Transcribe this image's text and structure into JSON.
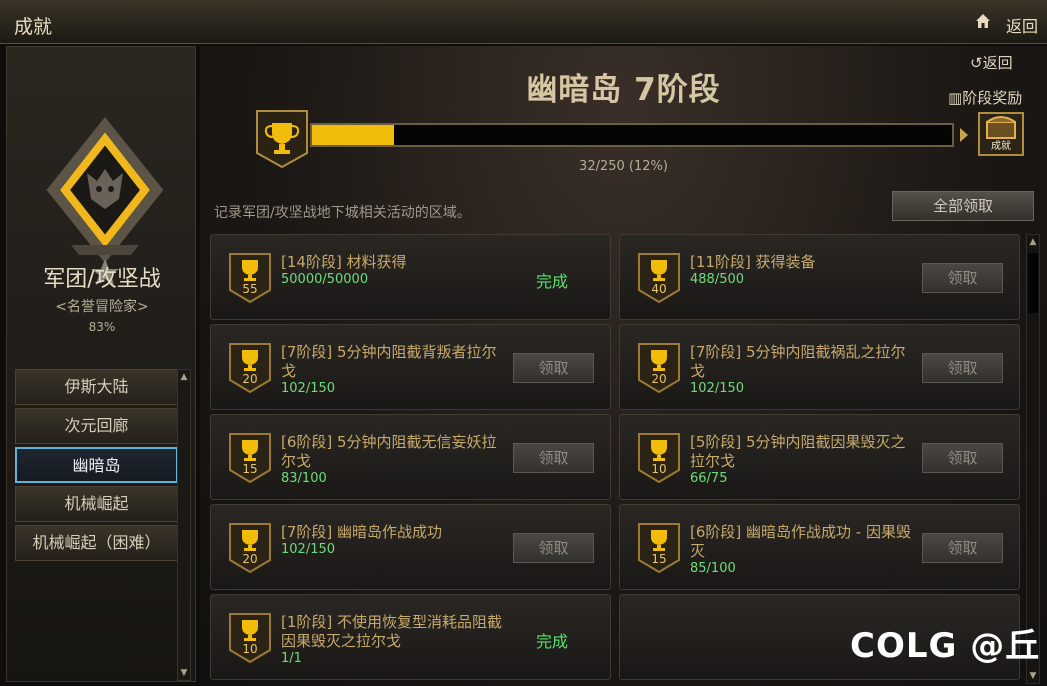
{
  "window": {
    "title": "成就",
    "back_label": "返回"
  },
  "sidebar": {
    "category_name": "军团/攻坚战",
    "category_title": "<名誉冒险家>",
    "category_percent": "83%",
    "nav_items": [
      {
        "label": "伊斯大陆",
        "active": false
      },
      {
        "label": "次元回廊",
        "active": false
      },
      {
        "label": "幽暗岛",
        "active": true
      },
      {
        "label": "机械崛起",
        "active": false
      },
      {
        "label": "机械崛起（困难）",
        "active": false
      }
    ]
  },
  "main": {
    "back_label": "返回",
    "stage_reward_label": "阶段奖励",
    "stage_title": "幽暗岛 7阶段",
    "progress": {
      "current": 32,
      "total": 250,
      "fraction": 0.128,
      "text": "32/250 (12%)"
    },
    "reward_chest_label": "成就",
    "description": "记录军团/攻坚战地下城相关活动的区域。",
    "claim_all_label": "全部领取",
    "achievements": [
      {
        "points": "55",
        "title": "[14阶段] 材料获得",
        "progress": "50000/50000",
        "status": "完成"
      },
      {
        "points": "40",
        "title": "[11阶段] 获得装备",
        "progress": "488/500",
        "status": "领取"
      },
      {
        "points": "20",
        "title": "[7阶段] 5分钟内阻截背叛者拉尔戈",
        "progress": "102/150",
        "status": "领取"
      },
      {
        "points": "20",
        "title": "[7阶段] 5分钟内阻截祸乱之拉尔戈",
        "progress": "102/150",
        "status": "领取"
      },
      {
        "points": "15",
        "title": "[6阶段] 5分钟内阻截无信妄妖拉尔戈",
        "progress": "83/100",
        "status": "领取"
      },
      {
        "points": "10",
        "title": "[5阶段] 5分钟内阻截因果毁灭之拉尔戈",
        "progress": "66/75",
        "status": "领取"
      },
      {
        "points": "20",
        "title": "[7阶段] 幽暗岛作战成功",
        "progress": "102/150",
        "status": "领取"
      },
      {
        "points": "15",
        "title": "[6阶段] 幽暗岛作战成功 - 因果毁灭",
        "progress": "85/100",
        "status": "领取"
      },
      {
        "points": "10",
        "title": "[1阶段] 不使用恢复型消耗品阻截因果毁灭之拉尔戈",
        "progress": "1/1",
        "status": "完成"
      }
    ]
  },
  "watermark": "COLG @丘",
  "icons": [
    "home-icon",
    "back-arrow-icon",
    "stage-reward-icon",
    "trophy-icon",
    "reward-chest-icon",
    "guild-emblem-icon"
  ],
  "colors": {
    "progress_fill": "#f2bd0a",
    "complete_text": "#58e06a",
    "progress_text": "#6fdc7c",
    "title_text": "#c7a96a",
    "active_nav_border": "#5fb3d6"
  }
}
